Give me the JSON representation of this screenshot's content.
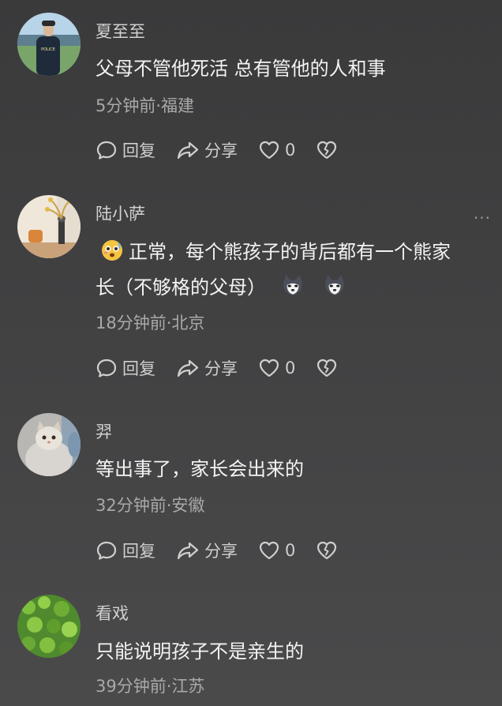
{
  "comments": [
    {
      "username": "夏至至",
      "content": "父母不管他死活 总有管他的人和事",
      "meta": "5分钟前·福建",
      "reply_label": "回复",
      "share_label": "分享",
      "like_count": "0",
      "avatar_text": "POLICE"
    },
    {
      "username": "陆小萨",
      "content_line1": "正常，每个熊孩子的背后都有一个熊家",
      "content_line2": "长（不够格的父母）",
      "meta": "18分钟前·北京",
      "reply_label": "回复",
      "share_label": "分享",
      "like_count": "0",
      "more": "···"
    },
    {
      "username": "羿",
      "content": "等出事了，家长会出来的",
      "meta": "32分钟前·安徽",
      "reply_label": "回复",
      "share_label": "分享",
      "like_count": "0"
    },
    {
      "username": "看戏",
      "content": "只能说明孩子不是亲生的",
      "meta": "39分钟前·江苏"
    }
  ]
}
